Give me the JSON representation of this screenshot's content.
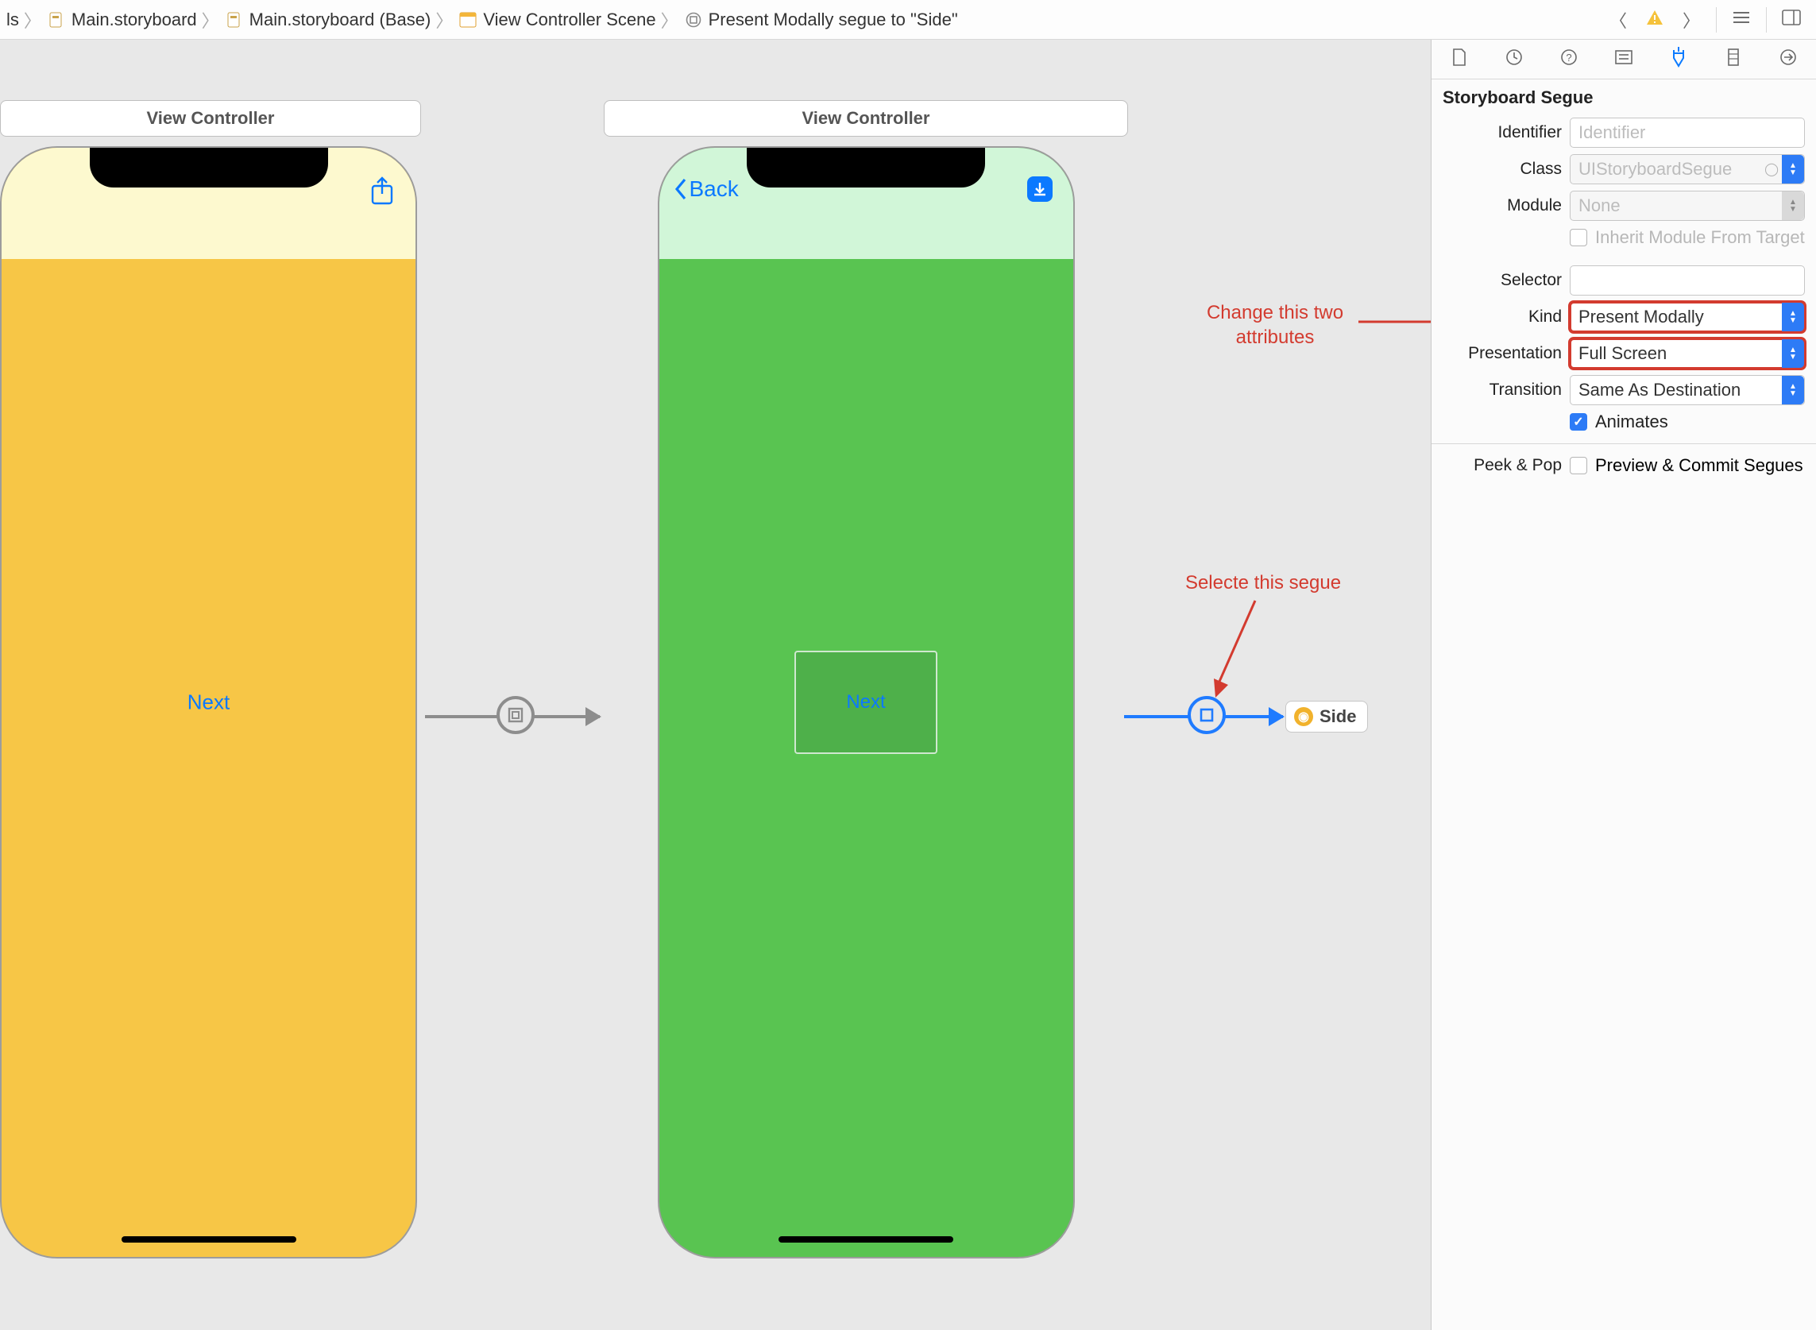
{
  "breadcrumbs": {
    "b0_suffix": "ls",
    "b1": "Main.storyboard",
    "b2": "Main.storyboard (Base)",
    "b3": "View Controller Scene",
    "b4": "Present Modally segue to \"Side\""
  },
  "scenes": {
    "s1": {
      "title": "View Controller",
      "button": "Next"
    },
    "s2": {
      "title": "View Controller",
      "back": "Back",
      "button": "Next"
    },
    "side_ref": "Side"
  },
  "annotations": {
    "attrs": "Change this two\nattributes",
    "segue": "Selecte this segue"
  },
  "inspector": {
    "section": "Storyboard Segue",
    "labels": {
      "identifier": "Identifier",
      "klass": "Class",
      "module": "Module",
      "inherit": "Inherit Module From Target",
      "selector": "Selector",
      "kind": "Kind",
      "presentation": "Presentation",
      "transition": "Transition",
      "animates": "Animates",
      "peekpop": "Peek & Pop",
      "preview": "Preview & Commit Segues"
    },
    "values": {
      "identifier_placeholder": "Identifier",
      "klass": "UIStoryboardSegue",
      "module": "None",
      "kind": "Present Modally",
      "presentation": "Full Screen",
      "transition": "Same As Destination"
    }
  }
}
